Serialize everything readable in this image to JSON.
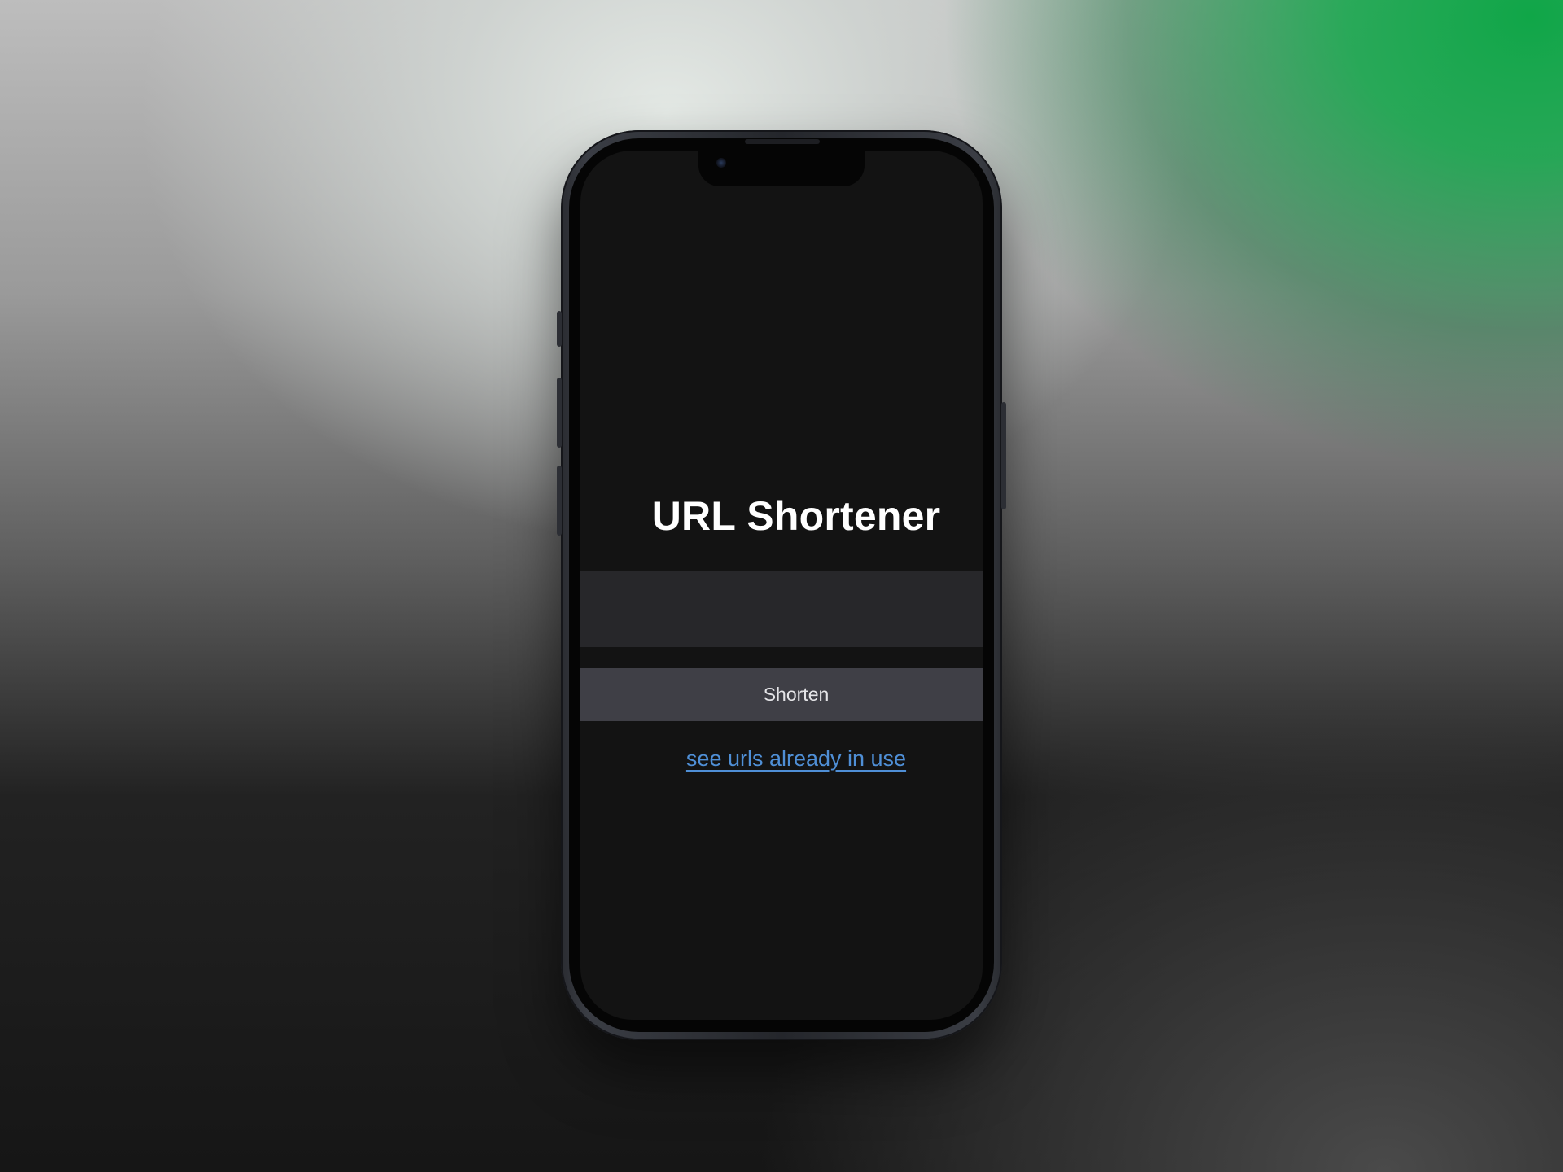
{
  "app": {
    "title": "URL Shortener"
  },
  "form": {
    "url_input_value": "",
    "url_input_placeholder": "",
    "shorten_label": "Shorten"
  },
  "links": {
    "see_urls_label": "see urls already in use"
  },
  "colors": {
    "background_accent": "#10a648",
    "screen_background": "#131313",
    "input_background": "#27272a",
    "button_background": "#3f3f46",
    "link": "#4f8fd6"
  }
}
